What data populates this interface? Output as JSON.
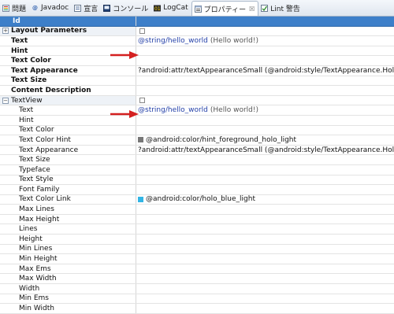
{
  "tabs": [
    {
      "label": "問題",
      "icon": "problems-icon",
      "active": false
    },
    {
      "label": "Javadoc",
      "icon": "javadoc-icon",
      "active": false
    },
    {
      "label": "宣言",
      "icon": "declaration-icon",
      "active": false
    },
    {
      "label": "コンソール",
      "icon": "console-icon",
      "active": false
    },
    {
      "label": "LogCat",
      "icon": "logcat-icon",
      "active": false
    },
    {
      "label": "プロパティー",
      "icon": "properties-icon",
      "active": true,
      "close": "☒"
    },
    {
      "label": "Lint 警告",
      "icon": "lint-icon",
      "active": false
    }
  ],
  "header": {
    "id_label": "Id"
  },
  "layout_section": {
    "label": "Layout Parameters",
    "toggle": "+",
    "rows": [
      {
        "name": "Text",
        "value": "@string/hello_world",
        "extra": "(Hello world!)"
      },
      {
        "name": "Hint",
        "value": "",
        "extra": ""
      },
      {
        "name": "Text Color",
        "value": "",
        "extra": ""
      },
      {
        "name": "Text Appearance",
        "value": "?android:attr/textAppearanceSmall (@android:style/TextAppearance.Holo.Light.Small)",
        "extra": ""
      },
      {
        "name": "Text Size",
        "value": "",
        "extra": ""
      },
      {
        "name": "Content Description",
        "value": "",
        "extra": ""
      }
    ]
  },
  "textview_section": {
    "label": "TextView",
    "toggle": "−",
    "rows": [
      {
        "name": "Text",
        "value": "@string/hello_world",
        "extra": "(Hello world!)"
      },
      {
        "name": "Hint",
        "value": "",
        "extra": ""
      },
      {
        "name": "Text Color",
        "value": "",
        "extra": ""
      },
      {
        "name": "Text Color Hint",
        "value": "@android:color/hint_foreground_holo_light",
        "extra": "",
        "swatch": "#777777"
      },
      {
        "name": "Text Appearance",
        "value": "?android:attr/textAppearanceSmall (@android:style/TextAppearance.Holo.Light.Small)",
        "extra": ""
      },
      {
        "name": "Text Size",
        "value": "",
        "extra": ""
      },
      {
        "name": "Typeface",
        "value": "",
        "extra": ""
      },
      {
        "name": "Text Style",
        "value": "",
        "extra": ""
      },
      {
        "name": "Font Family",
        "value": "",
        "extra": ""
      },
      {
        "name": "Text Color Link",
        "value": "@android:color/holo_blue_light",
        "extra": "",
        "swatch": "#33b5e5"
      },
      {
        "name": "Max Lines",
        "value": "",
        "extra": ""
      },
      {
        "name": "Max Height",
        "value": "",
        "extra": ""
      },
      {
        "name": "Lines",
        "value": "",
        "extra": ""
      },
      {
        "name": "Height",
        "value": "",
        "extra": ""
      },
      {
        "name": "Min Lines",
        "value": "",
        "extra": ""
      },
      {
        "name": "Min Height",
        "value": "",
        "extra": ""
      },
      {
        "name": "Max Ems",
        "value": "",
        "extra": ""
      },
      {
        "name": "Max Width",
        "value": "",
        "extra": ""
      },
      {
        "name": "Width",
        "value": "",
        "extra": ""
      },
      {
        "name": "Min Ems",
        "value": "",
        "extra": ""
      },
      {
        "name": "Min Width",
        "value": "",
        "extra": ""
      }
    ]
  },
  "colors": {
    "header": "#3d7fc9",
    "arrow": "#d42020"
  }
}
